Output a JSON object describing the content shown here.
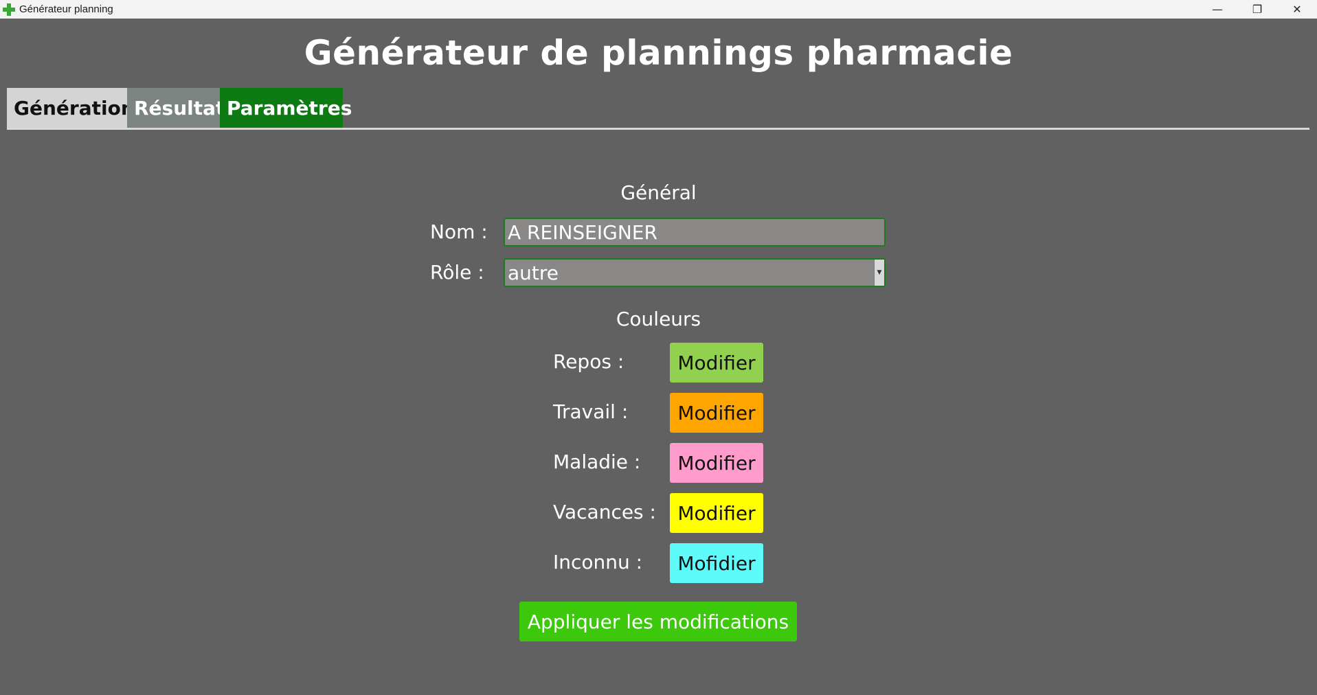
{
  "window": {
    "title": "Générateur planning",
    "minimize_glyph": "—",
    "maximize_glyph": "❐",
    "close_glyph": "✕"
  },
  "page": {
    "heading": "Générateur de plannings pharmacie"
  },
  "tabs": [
    {
      "label": "Génération"
    },
    {
      "label": "Résultat"
    },
    {
      "label": "Paramètres"
    }
  ],
  "general": {
    "title": "Général",
    "name_label": "Nom :",
    "name_value": "A REINSEIGNER",
    "role_label": "Rôle :",
    "role_value": "autre"
  },
  "colors": {
    "title": "Couleurs",
    "items": [
      {
        "label": "Repos :",
        "button": "Modifier",
        "color": "#92d050"
      },
      {
        "label": "Travail :",
        "button": "Modifier",
        "color": "#ffa500"
      },
      {
        "label": "Maladie :",
        "button": "Modifier",
        "color": "#ff9ccc"
      },
      {
        "label": "Vacances :",
        "button": "Modifier",
        "color": "#ffff00"
      },
      {
        "label": "Inconnu :",
        "button": "Mofidier",
        "color": "#5ffbfb"
      }
    ]
  },
  "apply_button": "Appliquer les modifications"
}
